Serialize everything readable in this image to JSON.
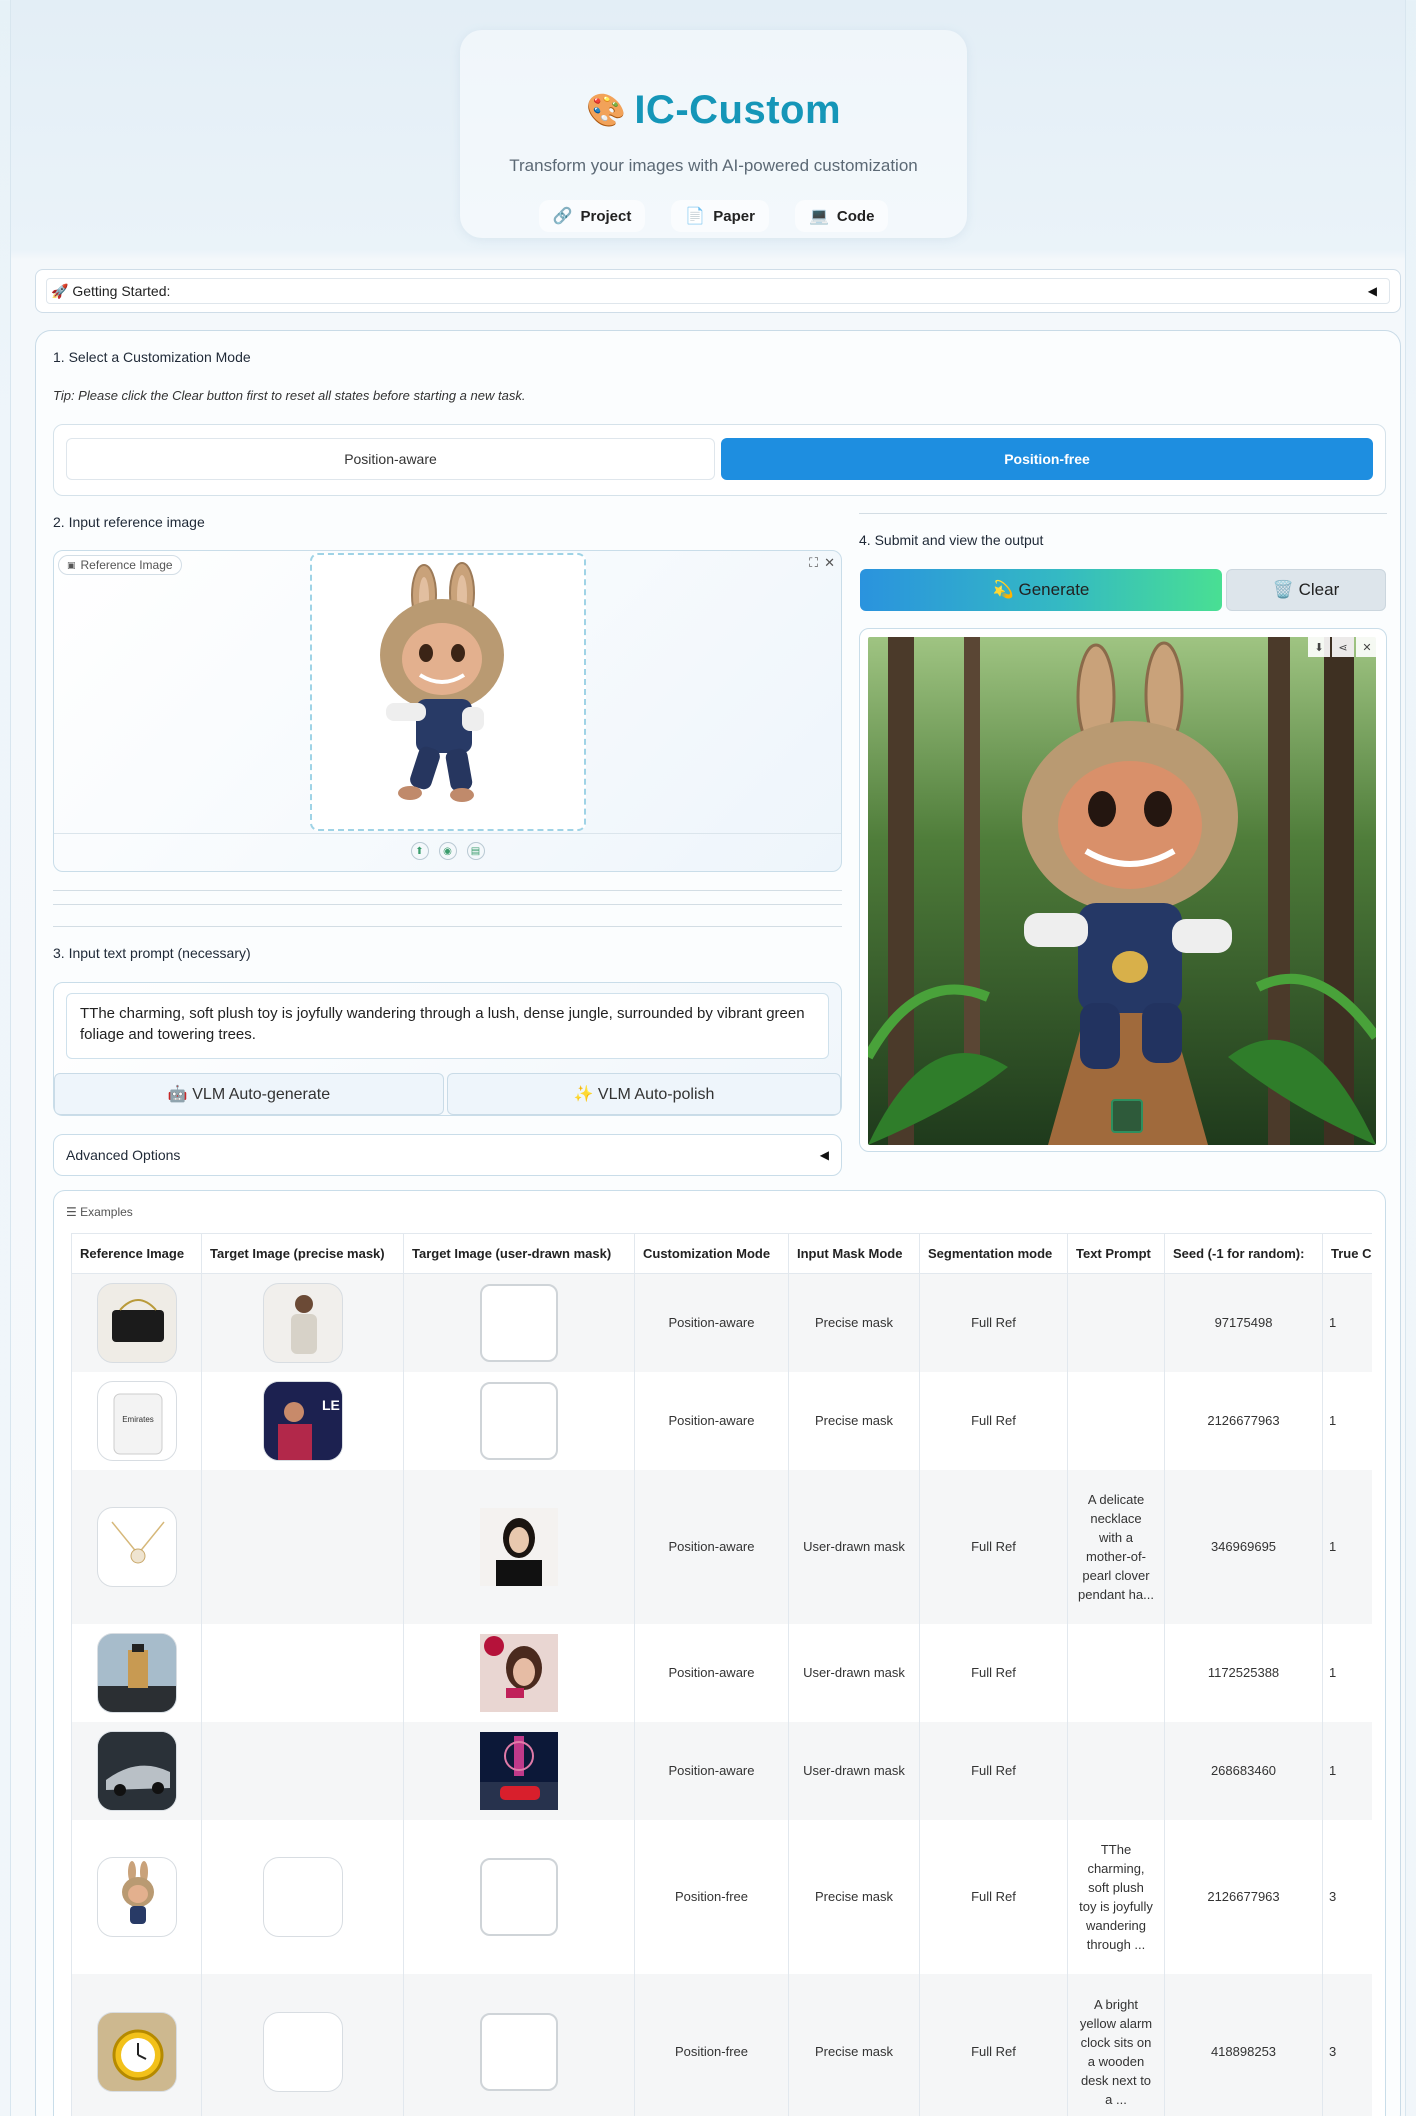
{
  "header": {
    "icon": "palette-icon",
    "title": "IC-Custom",
    "subtitle": "Transform your images with AI-powered customization",
    "links": [
      {
        "icon": "link-icon",
        "label": "Project"
      },
      {
        "icon": "page-icon",
        "label": "Paper"
      },
      {
        "icon": "laptop-icon",
        "label": "Code"
      }
    ]
  },
  "getting_started": {
    "label": "🚀 Getting Started:"
  },
  "step1": {
    "label": "1. Select a Customization Mode",
    "tip": "Tip: Please click the Clear button first to reset all states before starting a new task.",
    "modes": [
      "Position-aware",
      "Position-free"
    ],
    "selected": "Position-free"
  },
  "step2": {
    "label": "2. Input reference image",
    "tag": "Reference Image"
  },
  "step3": {
    "label": "3. Input text prompt (necessary)",
    "prompt": "TThe charming, soft plush toy is joyfully wandering through a lush, dense jungle, surrounded by vibrant green foliage and towering trees.",
    "vlm_generate": "🤖 VLM Auto-generate",
    "vlm_polish": "✨ VLM Auto-polish"
  },
  "advanced": {
    "label": "Advanced Options"
  },
  "step4": {
    "label": "4. Submit and view the output",
    "generate": "💫 Generate",
    "clear": "🗑️ Clear"
  },
  "examples": {
    "label": "Examples",
    "headers": [
      "Reference Image",
      "Target Image (precise mask)",
      "Target Image (user-drawn mask)",
      "Customization Mode",
      "Input Mask Mode",
      "Segmentation mode",
      "Text Prompt",
      "Seed (-1 for random):",
      "True CFG"
    ],
    "rows": [
      {
        "mode": "Position-aware",
        "mask": "Precise mask",
        "seg": "Full Ref",
        "prompt": "",
        "seed": "97175498",
        "cfg": "1"
      },
      {
        "mode": "Position-aware",
        "mask": "Precise mask",
        "seg": "Full Ref",
        "prompt": "",
        "seed": "2126677963",
        "cfg": "1"
      },
      {
        "mode": "Position-aware",
        "mask": "User-drawn mask",
        "seg": "Full Ref",
        "prompt": "A delicate necklace with a mother-of-pearl clover pendant ha...",
        "seed": "346969695",
        "cfg": "1"
      },
      {
        "mode": "Position-aware",
        "mask": "User-drawn mask",
        "seg": "Full Ref",
        "prompt": "",
        "seed": "1172525388",
        "cfg": "1"
      },
      {
        "mode": "Position-aware",
        "mask": "User-drawn mask",
        "seg": "Full Ref",
        "prompt": "",
        "seed": "268683460",
        "cfg": "1"
      },
      {
        "mode": "Position-free",
        "mask": "Precise mask",
        "seg": "Full Ref",
        "prompt": "TThe charming, soft plush toy is joyfully wandering through ...",
        "seed": "2126677963",
        "cfg": "3"
      },
      {
        "mode": "Position-free",
        "mask": "Precise mask",
        "seg": "Full Ref",
        "prompt": "A bright yellow alarm clock sits on a wooden desk next to a ...",
        "seed": "418898253",
        "cfg": "3"
      }
    ]
  }
}
